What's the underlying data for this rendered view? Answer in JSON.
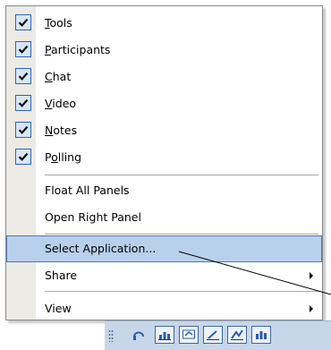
{
  "menu": {
    "checked_items": [
      {
        "label": "Tools",
        "mnemonic": "T",
        "rest": "ools",
        "checked": true
      },
      {
        "label": "Participants",
        "mnemonic": "P",
        "rest": "articipants",
        "checked": true
      },
      {
        "label": "Chat",
        "mnemonic": "C",
        "rest": "hat",
        "checked": true
      },
      {
        "label": "Video",
        "mnemonic": "V",
        "rest": "ideo",
        "checked": true
      },
      {
        "label": "Notes",
        "mnemonic": "N",
        "rest": "otes",
        "checked": true
      },
      {
        "label": "Polling",
        "pre": "P",
        "mnemonic": "o",
        "rest": "lling",
        "checked": true
      }
    ],
    "float_all_panels": "Float All Panels",
    "open_right_panel": "Open Right Panel",
    "select_application": "Select Application...",
    "share": "Share",
    "view": "View"
  },
  "colors": {
    "highlight": "#b8d0ec",
    "check_border": "#2f62b8",
    "gutter": "#eceae4"
  },
  "toolbar": {
    "icons": [
      "grip-icon",
      "headset-icon",
      "chart-icon",
      "whiteboard-icon",
      "pen-icon",
      "annotate-icon",
      "bar-chart-icon"
    ]
  }
}
